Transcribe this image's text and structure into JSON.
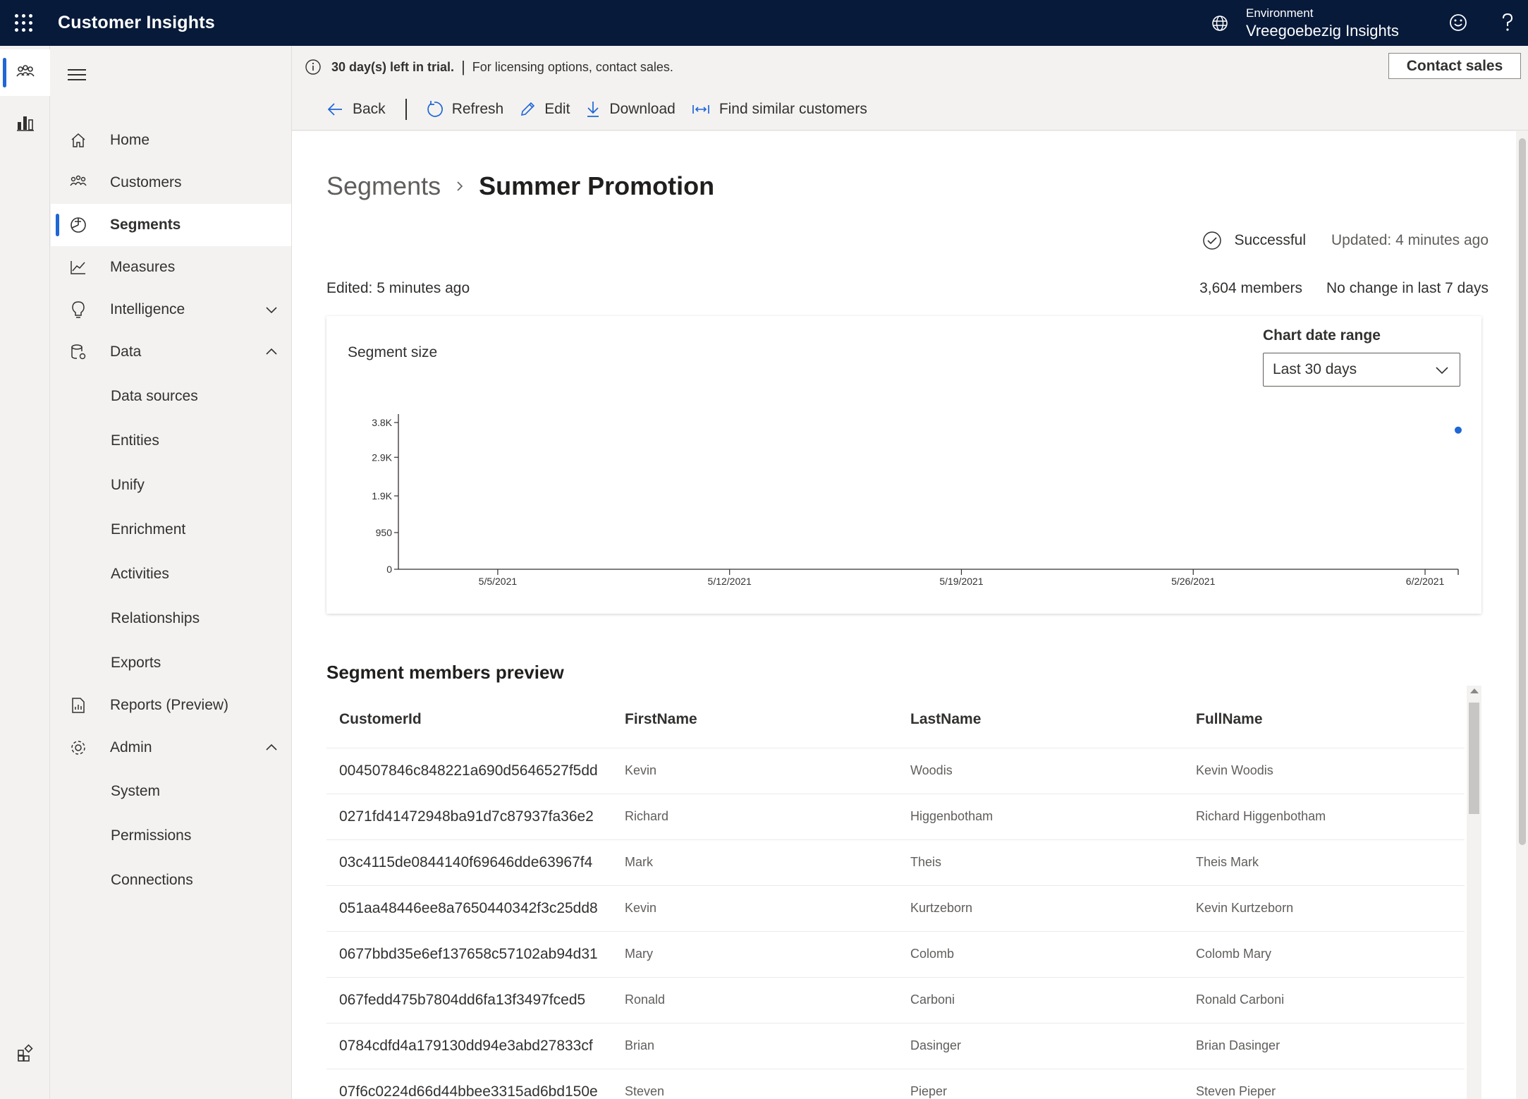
{
  "app": {
    "title": "Customer Insights"
  },
  "environment": {
    "label": "Environment",
    "name": "Vreegoebezig Insights"
  },
  "trial": {
    "days_left": "30 day(s) left in trial.",
    "separator": "|",
    "message": "For licensing options, contact sales.",
    "contact_button": "Contact sales"
  },
  "commands": {
    "back": "Back",
    "refresh": "Refresh",
    "edit": "Edit",
    "download": "Download",
    "find_similar": "Find similar customers"
  },
  "nav": {
    "items": [
      {
        "label": "Home",
        "icon": "home-icon"
      },
      {
        "label": "Customers",
        "icon": "people-icon"
      },
      {
        "label": "Segments",
        "icon": "segments-icon",
        "active": true
      },
      {
        "label": "Measures",
        "icon": "line-chart-icon"
      },
      {
        "label": "Intelligence",
        "icon": "lightbulb-icon",
        "expanded": false
      },
      {
        "label": "Data",
        "icon": "database-icon",
        "expanded": true
      },
      {
        "label": "Reports (Preview)",
        "icon": "report-icon"
      },
      {
        "label": "Admin",
        "icon": "gear-icon",
        "expanded": true
      }
    ],
    "data_children": [
      "Data sources",
      "Entities",
      "Unify",
      "Enrichment",
      "Activities",
      "Relationships",
      "Exports"
    ],
    "admin_children": [
      "System",
      "Permissions",
      "Connections"
    ]
  },
  "page": {
    "breadcrumb_parent": "Segments",
    "breadcrumb_current": "Summer Promotion",
    "status": "Successful",
    "updated": "Updated: 4 minutes ago",
    "edited": "Edited: 5 minutes ago",
    "member_count": "3,604 members",
    "change": "No change in last 7 days"
  },
  "chart_card": {
    "title": "Segment size",
    "range_label": "Chart date range",
    "range_value": "Last 30 days"
  },
  "chart_data": {
    "type": "scatter",
    "title": "Segment size",
    "y_ticks": [
      "0",
      "950",
      "1.9K",
      "2.9K",
      "3.8K"
    ],
    "y_tick_values": [
      0,
      950,
      1900,
      2900,
      3800
    ],
    "x_ticks": [
      "5/5/2021",
      "5/12/2021",
      "5/19/2021",
      "5/26/2021",
      "6/2/2021"
    ],
    "ylim": [
      0,
      3800
    ],
    "xlim": [
      "5/2/2021",
      "6/3/2021"
    ],
    "points": [
      {
        "x": "6/3/2021",
        "y": 3604
      }
    ],
    "point_color": "#1f66d6"
  },
  "preview": {
    "title": "Segment members preview",
    "columns": [
      "CustomerId",
      "FirstName",
      "LastName",
      "FullName"
    ],
    "rows": [
      [
        "004507846c848221a690d5646527f5dd",
        "Kevin",
        "Woodis",
        "Kevin Woodis"
      ],
      [
        "0271fd41472948ba91d7c87937fa36e2",
        "Richard",
        "Higgenbotham",
        "Richard Higgenbotham"
      ],
      [
        "03c4115de0844140f69646dde63967f4",
        "Mark",
        "Theis",
        "Theis Mark"
      ],
      [
        "051aa48446ee8a7650440342f3c25dd8",
        "Kevin",
        "Kurtzeborn",
        "Kevin Kurtzeborn"
      ],
      [
        "0677bbd35e6ef137658c57102ab94d31",
        "Mary",
        "Colomb",
        "Colomb Mary"
      ],
      [
        "067fedd475b7804dd6fa13f3497fced5",
        "Ronald",
        "Carboni",
        "Ronald Carboni"
      ],
      [
        "0784cdfd4a179130dd94e3abd27833cf",
        "Brian",
        "Dasinger",
        "Brian Dasinger"
      ],
      [
        "07f6c0224d66d44bbee3315ad6bd150e",
        "Steven",
        "Pieper",
        "Steven Pieper"
      ]
    ]
  }
}
